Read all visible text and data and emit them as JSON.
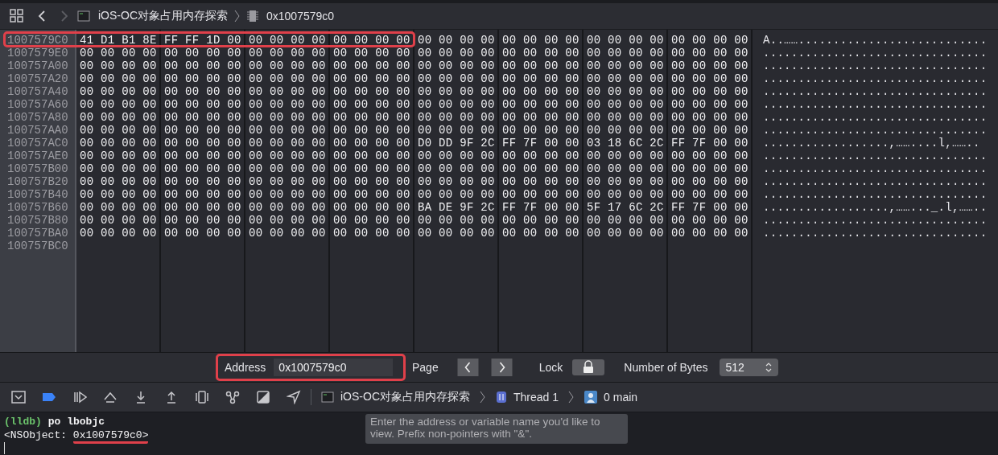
{
  "toolbar": {
    "back": {
      "disabled": false
    },
    "forward": {
      "disabled": true
    },
    "breadcrumbs": [
      {
        "kind": "project",
        "label": "iOS-OC对象占用内存探索"
      },
      {
        "kind": "memory",
        "label": "0x1007579c0"
      }
    ]
  },
  "memory": {
    "rows": [
      {
        "address": "1007579C0",
        "highlighted": true,
        "groups": [
          "41 D1 B1 8E",
          "FF FF 1D 00",
          "00 00 00 00",
          "00 00 00 00",
          "00 00 00 00",
          "00 00 00 00",
          "00 00 00 00",
          "00 00 00 00"
        ],
        "ascii": "A..……..........................."
      },
      {
        "address": "1007579E0",
        "highlighted": false,
        "groups": [
          "00 00 00 00",
          "00 00 00 00",
          "00 00 00 00",
          "00 00 00 00",
          "00 00 00 00",
          "00 00 00 00",
          "00 00 00 00",
          "00 00 00 00"
        ],
        "ascii": "................................"
      },
      {
        "address": "100757A00",
        "highlighted": false,
        "groups": [
          "00 00 00 00",
          "00 00 00 00",
          "00 00 00 00",
          "00 00 00 00",
          "00 00 00 00",
          "00 00 00 00",
          "00 00 00 00",
          "00 00 00 00"
        ],
        "ascii": "................................"
      },
      {
        "address": "100757A20",
        "highlighted": false,
        "groups": [
          "00 00 00 00",
          "00 00 00 00",
          "00 00 00 00",
          "00 00 00 00",
          "00 00 00 00",
          "00 00 00 00",
          "00 00 00 00",
          "00 00 00 00"
        ],
        "ascii": "................................"
      },
      {
        "address": "100757A40",
        "highlighted": false,
        "groups": [
          "00 00 00 00",
          "00 00 00 00",
          "00 00 00 00",
          "00 00 00 00",
          "00 00 00 00",
          "00 00 00 00",
          "00 00 00 00",
          "00 00 00 00"
        ],
        "ascii": "................................"
      },
      {
        "address": "100757A60",
        "highlighted": false,
        "groups": [
          "00 00 00 00",
          "00 00 00 00",
          "00 00 00 00",
          "00 00 00 00",
          "00 00 00 00",
          "00 00 00 00",
          "00 00 00 00",
          "00 00 00 00"
        ],
        "ascii": "................................"
      },
      {
        "address": "100757A80",
        "highlighted": false,
        "groups": [
          "00 00 00 00",
          "00 00 00 00",
          "00 00 00 00",
          "00 00 00 00",
          "00 00 00 00",
          "00 00 00 00",
          "00 00 00 00",
          "00 00 00 00"
        ],
        "ascii": "................................"
      },
      {
        "address": "100757AA0",
        "highlighted": false,
        "groups": [
          "00 00 00 00",
          "00 00 00 00",
          "00 00 00 00",
          "00 00 00 00",
          "00 00 00 00",
          "00 00 00 00",
          "00 00 00 00",
          "00 00 00 00"
        ],
        "ascii": "................................"
      },
      {
        "address": "100757AC0",
        "highlighted": false,
        "groups": [
          "00 00 00 00",
          "00 00 00 00",
          "00 00 00 00",
          "00 00 00 00",
          "D0 DD 9F 2C",
          "FF 7F 00 00",
          "03 18 6C 2C",
          "FF 7F 00 00"
        ],
        "ascii": "..................,……....l,…….."
      },
      {
        "address": "100757AE0",
        "highlighted": false,
        "groups": [
          "00 00 00 00",
          "00 00 00 00",
          "00 00 00 00",
          "00 00 00 00",
          "00 00 00 00",
          "00 00 00 00",
          "00 00 00 00",
          "00 00 00 00"
        ],
        "ascii": "................................"
      },
      {
        "address": "100757B00",
        "highlighted": false,
        "groups": [
          "00 00 00 00",
          "00 00 00 00",
          "00 00 00 00",
          "00 00 00 00",
          "00 00 00 00",
          "00 00 00 00",
          "00 00 00 00",
          "00 00 00 00"
        ],
        "ascii": "................................"
      },
      {
        "address": "100757B20",
        "highlighted": false,
        "groups": [
          "00 00 00 00",
          "00 00 00 00",
          "00 00 00 00",
          "00 00 00 00",
          "00 00 00 00",
          "00 00 00 00",
          "00 00 00 00",
          "00 00 00 00"
        ],
        "ascii": "................................"
      },
      {
        "address": "100757B40",
        "highlighted": false,
        "groups": [
          "00 00 00 00",
          "00 00 00 00",
          "00 00 00 00",
          "00 00 00 00",
          "00 00 00 00",
          "00 00 00 00",
          "00 00 00 00",
          "00 00 00 00"
        ],
        "ascii": "................................"
      },
      {
        "address": "100757B60",
        "highlighted": false,
        "groups": [
          "00 00 00 00",
          "00 00 00 00",
          "00 00 00 00",
          "00 00 00 00",
          "BA DE 9F 2C",
          "FF 7F 00 00",
          "5F 17 6C 2C",
          "FF 7F 00 00"
        ],
        "ascii": "..................,……..._.l,…….."
      },
      {
        "address": "100757B80",
        "highlighted": false,
        "groups": [
          "00 00 00 00",
          "00 00 00 00",
          "00 00 00 00",
          "00 00 00 00",
          "00 00 00 00",
          "00 00 00 00",
          "00 00 00 00",
          "00 00 00 00"
        ],
        "ascii": "................................"
      },
      {
        "address": "100757BA0",
        "highlighted": false,
        "groups": [
          "00 00 00 00",
          "00 00 00 00",
          "00 00 00 00",
          "00 00 00 00",
          "00 00 00 00",
          "00 00 00 00",
          "00 00 00 00",
          "00 00 00 00"
        ],
        "ascii": "................................"
      },
      {
        "address": "100757BC0",
        "highlighted": false
      }
    ]
  },
  "controls": {
    "address_label": "Address",
    "address_value": "0x1007579c0",
    "address_highlighted": true,
    "page_label": "Page",
    "lock_label": "Lock",
    "bytes_label": "Number of Bytes",
    "bytes_value": "512"
  },
  "debug_bar": {
    "breadcrumbs": [
      {
        "kind": "project",
        "label": "iOS-OC对象占用内存探索"
      },
      {
        "kind": "thread",
        "label": "Thread 1"
      },
      {
        "kind": "frame",
        "label": "0 main"
      }
    ],
    "tooltip": "Enter the address or variable name you'd like to view. Prefix non-pointers with \"&\"."
  },
  "console": {
    "lines": [
      {
        "kind": "command",
        "prompt": "(lldb)",
        "text": "po lbobjc"
      },
      {
        "kind": "output",
        "text": "<NSObject: ",
        "value": "0x1007579c0>",
        "underlined": true
      }
    ]
  }
}
